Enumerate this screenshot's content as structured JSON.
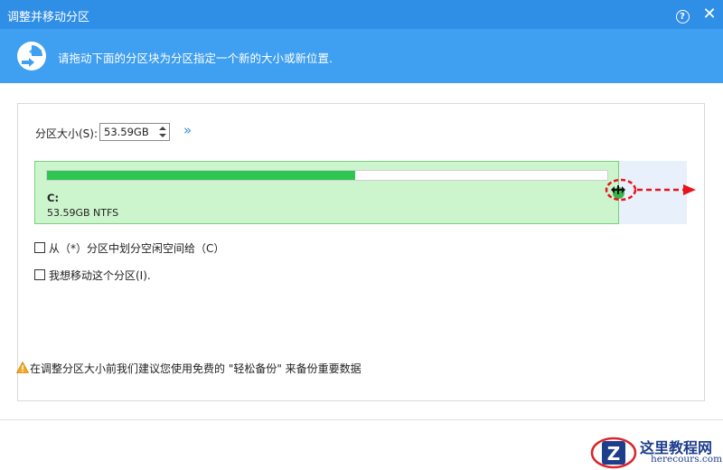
{
  "window": {
    "title": "调整并移动分区",
    "help_label": "?",
    "close_label": "✕"
  },
  "banner": {
    "text": "请拖动下面的分区块为分区指定一个新的大小或新位置.",
    "icon": "move-partition-icon"
  },
  "size_control": {
    "label": "分区大小(S):",
    "value": "53.59GB",
    "expand_label": "»"
  },
  "partition": {
    "name": "C:",
    "info": "53.59GB NTFS",
    "usage_fraction": 0.55
  },
  "options": [
    {
      "label": "从（*）分区中划分空闲空间给（C）",
      "checked": false
    },
    {
      "label": "我想移动这个分区(I).",
      "checked": false
    }
  ],
  "tip": {
    "text": "在调整分区大小前我们建议您使用免费的 \"轻松备份\" 来备份重要数据",
    "icon": "warning-icon"
  },
  "watermark": {
    "title": "这里教程网",
    "url": "herecours.com",
    "badge_letter": "Z"
  },
  "colors": {
    "titlebar": "#2f8ee6",
    "banner": "#3f9ff0",
    "partition_fill": "#cdf5cd",
    "usage_bar": "#2ec653",
    "annotation_red": "#e8141b"
  }
}
